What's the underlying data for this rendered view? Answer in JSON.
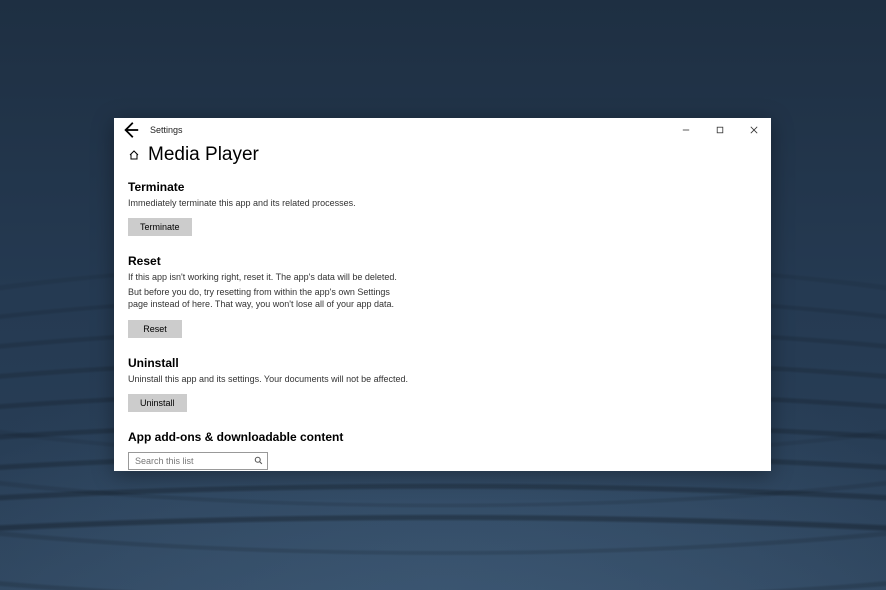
{
  "window": {
    "app_title": "Settings"
  },
  "header": {
    "page_title": "Media Player"
  },
  "sections": {
    "terminate": {
      "heading": "Terminate",
      "description": "Immediately terminate this app and its related processes.",
      "button_label": "Terminate"
    },
    "reset": {
      "heading": "Reset",
      "description1": "If this app isn't working right, reset it. The app's data will be deleted.",
      "description2": "But before you do, try resetting from within the app's own Settings page instead of here. That way, you won't lose all of your app data.",
      "button_label": "Reset"
    },
    "uninstall": {
      "heading": "Uninstall",
      "description": "Uninstall this app and its settings. Your documents will not be affected.",
      "button_label": "Uninstall"
    },
    "addons": {
      "heading": "App add-ons & downloadable content",
      "search_placeholder": "Search this list"
    }
  }
}
